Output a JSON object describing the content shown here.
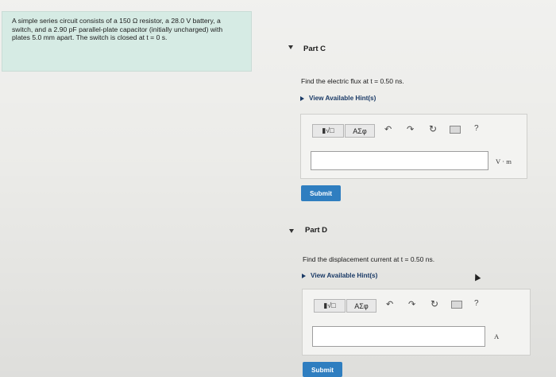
{
  "problem": {
    "text": "A simple series circuit consists of a 150 Ω resistor, a 28.0 V battery, a switch, and a 2.90 pF parallel-plate capacitor (initially uncharged) with plates 5.0 mm apart. The switch is closed at t = 0 s."
  },
  "parts": [
    {
      "label": "Part C",
      "question": "Find the electric flux at t = 0.50 ns.",
      "hint": "View Available Hint(s)",
      "toolbar": {
        "math_btn": "▮√□",
        "greek_btn": "ΑΣφ",
        "help": "?"
      },
      "answer_value": "",
      "unit": "V · m",
      "submit": "Submit"
    },
    {
      "label": "Part D",
      "question": "Find the displacement current at t = 0.50 ns.",
      "hint": "View Available Hint(s)",
      "toolbar": {
        "math_btn": "▮√□",
        "greek_btn": "ΑΣφ",
        "help": "?"
      },
      "answer_value": "",
      "unit": "A",
      "submit": "Submit"
    }
  ],
  "colors": {
    "problem_bg": "#d6ebe4",
    "submit_bg": "#2f7ec0",
    "hint_text": "#1a3a66"
  }
}
